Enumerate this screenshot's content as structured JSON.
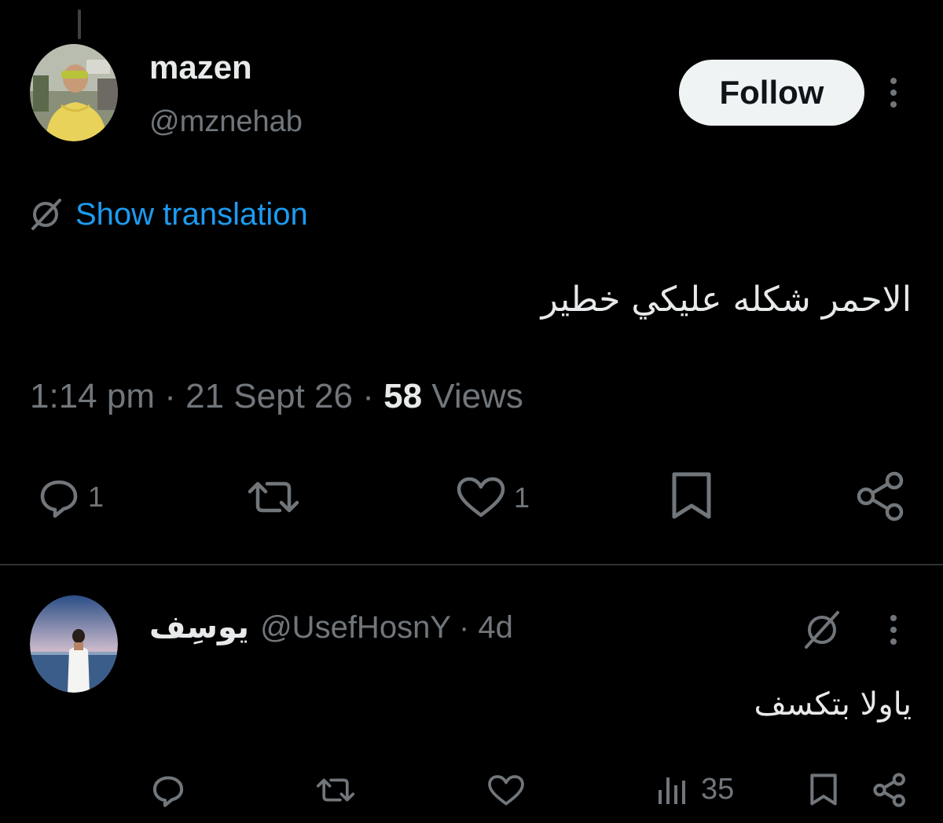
{
  "tweet": {
    "author": {
      "name": "mazen",
      "handle": "@mznehab"
    },
    "follow_label": "Follow",
    "show_translation_label": "Show translation",
    "text": "الاحمر شكله عليكي خطير",
    "time": "1:14 pm",
    "separator": "·",
    "date": "21 Sept 26",
    "views_count": "58",
    "views_label": "Views",
    "actions": {
      "reply_count": "1",
      "like_count": "1"
    }
  },
  "reply": {
    "author": {
      "name": "يوسِف",
      "handle": "@UsefHosnY",
      "age": "· 4d"
    },
    "text": "ياولا بتكسف",
    "views_count": "35"
  },
  "colors": {
    "background": "#000000",
    "text_primary": "#e7e9ea",
    "text_secondary": "#71767b",
    "link": "#1d9bf0",
    "divider": "#2f3336"
  }
}
